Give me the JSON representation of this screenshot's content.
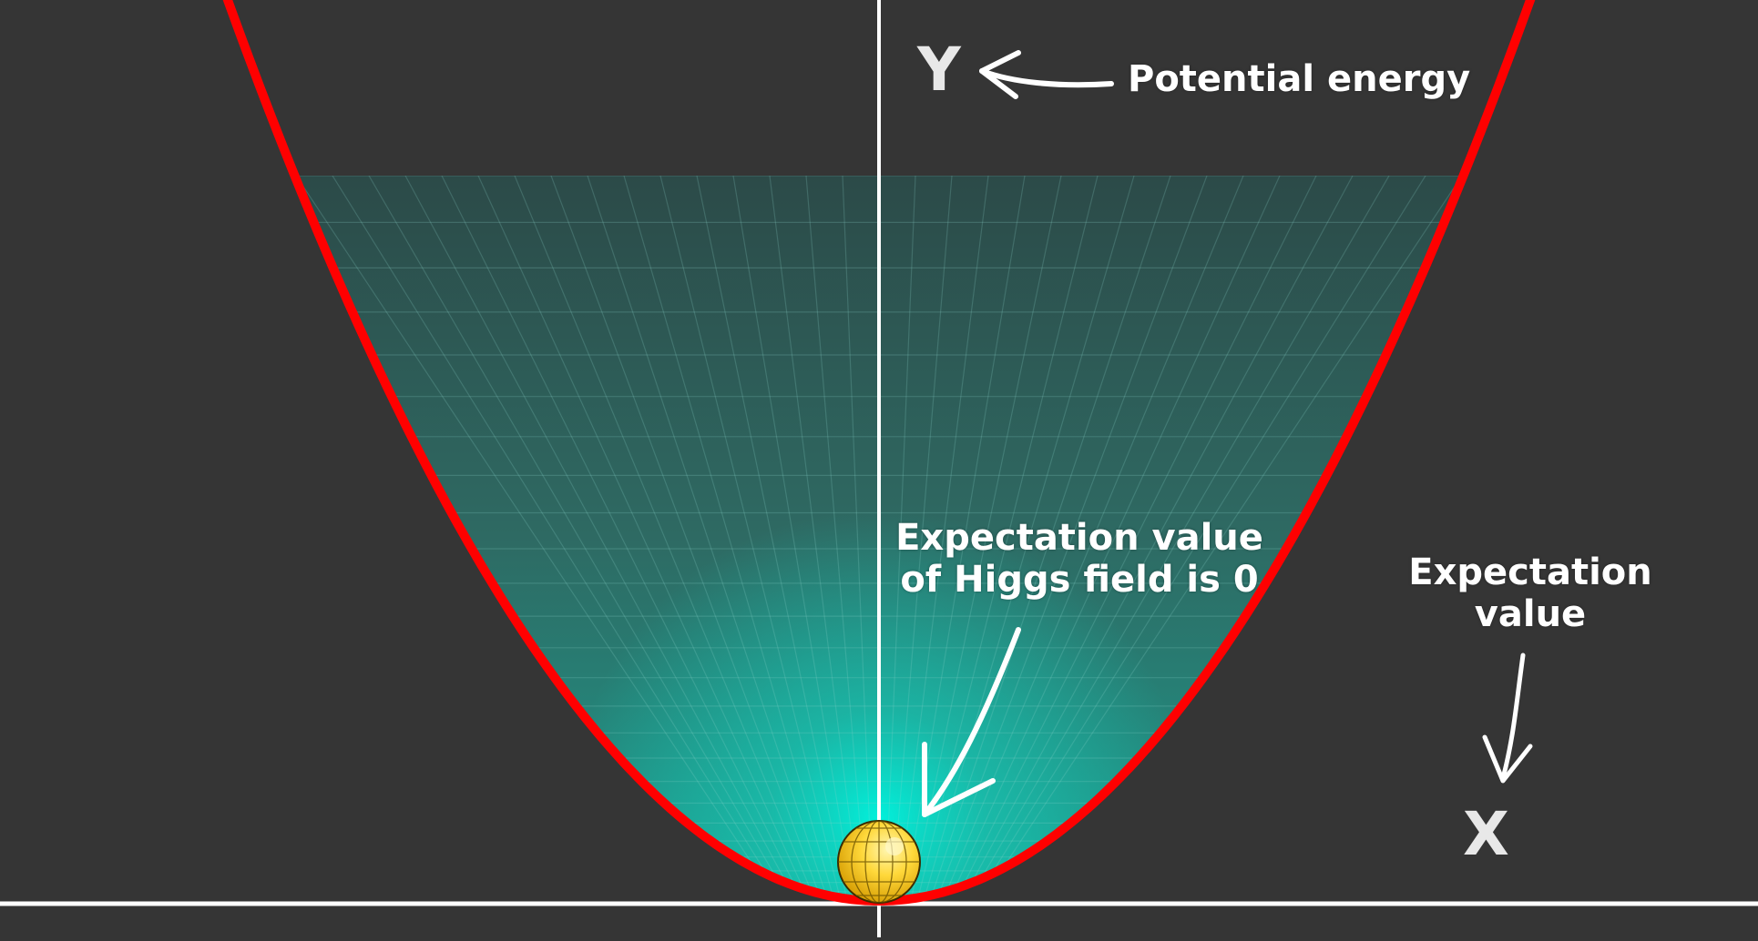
{
  "labels": {
    "y_axis": "Y",
    "x_axis": "X",
    "potential_energy": "Potential energy",
    "expectation_zero_line1": "Expectation value",
    "expectation_zero_line2": "of Higgs field is 0",
    "expectation_value_line1": "Expectation",
    "expectation_value_line2": "value"
  },
  "colors": {
    "background": "#353535",
    "curve": "#ff0000",
    "surface": "#1fb8a6",
    "surface_glow": "#00f5e0",
    "ball": "#ffd83a",
    "axes": "#ffffff"
  },
  "icons": [
    "arrow-to-y-icon",
    "arrow-to-ball-icon",
    "arrow-to-x-icon",
    "higgs-ball-icon"
  ]
}
